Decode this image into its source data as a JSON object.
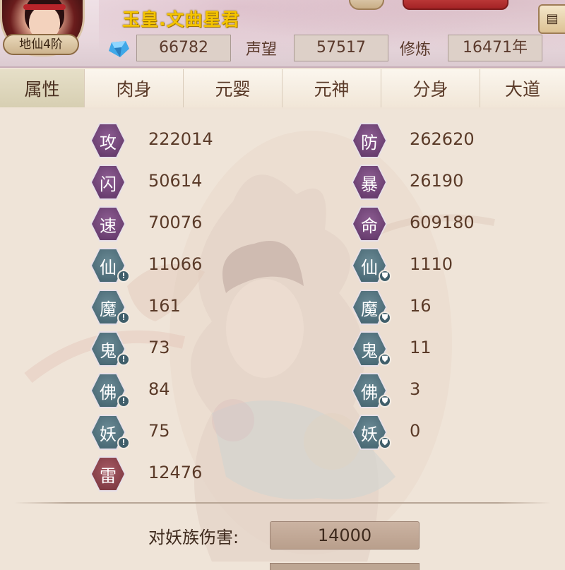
{
  "player": {
    "name": "玉皇.文曲星君",
    "rank": "地仙4阶"
  },
  "currency": {
    "gem_icon": "blue-gem-icon",
    "gems": "66782"
  },
  "stats": {
    "reputation_label": "声望",
    "reputation": "57517",
    "cultivation_label": "修炼",
    "cultivation": "16471年"
  },
  "tabs": [
    {
      "label": "属性",
      "active": true
    },
    {
      "label": "肉身",
      "active": false
    },
    {
      "label": "元婴",
      "active": false
    },
    {
      "label": "元神",
      "active": false
    },
    {
      "label": "分身",
      "active": false
    },
    {
      "label": "大道",
      "active": false
    }
  ],
  "attributes_left": [
    {
      "glyph": "攻",
      "value": "222014",
      "color": "purple",
      "badge": ""
    },
    {
      "glyph": "闪",
      "value": "50614",
      "color": "purple",
      "badge": ""
    },
    {
      "glyph": "速",
      "value": "70076",
      "color": "purple",
      "badge": ""
    },
    {
      "glyph": "仙",
      "value": "11066",
      "color": "teal",
      "badge": "!"
    },
    {
      "glyph": "魔",
      "value": "161",
      "color": "teal",
      "badge": "!"
    },
    {
      "glyph": "鬼",
      "value": "73",
      "color": "teal",
      "badge": "!"
    },
    {
      "glyph": "佛",
      "value": "84",
      "color": "teal",
      "badge": "!"
    },
    {
      "glyph": "妖",
      "value": "75",
      "color": "teal",
      "badge": "!"
    },
    {
      "glyph": "雷",
      "value": "12476",
      "color": "red",
      "badge": ""
    }
  ],
  "attributes_right": [
    {
      "glyph": "防",
      "value": "262620",
      "color": "purple",
      "badge": ""
    },
    {
      "glyph": "暴",
      "value": "26190",
      "color": "purple",
      "badge": ""
    },
    {
      "glyph": "命",
      "value": "609180",
      "color": "purple",
      "badge": ""
    },
    {
      "glyph": "仙",
      "value": "1110",
      "color": "teal",
      "badge": "⛊"
    },
    {
      "glyph": "魔",
      "value": "16",
      "color": "teal",
      "badge": "⛊"
    },
    {
      "glyph": "鬼",
      "value": "11",
      "color": "teal",
      "badge": "⛊"
    },
    {
      "glyph": "佛",
      "value": "3",
      "color": "teal",
      "badge": "⛊"
    },
    {
      "glyph": "妖",
      "value": "0",
      "color": "teal",
      "badge": "⛊"
    }
  ],
  "damage": {
    "demon_label": "对妖族伤害:",
    "demon_value": "14000"
  },
  "colors": {
    "name_gold": "#f5c400",
    "hex_purple": "#6f4377",
    "hex_teal": "#4e6e79",
    "hex_red": "#8a3e48"
  }
}
